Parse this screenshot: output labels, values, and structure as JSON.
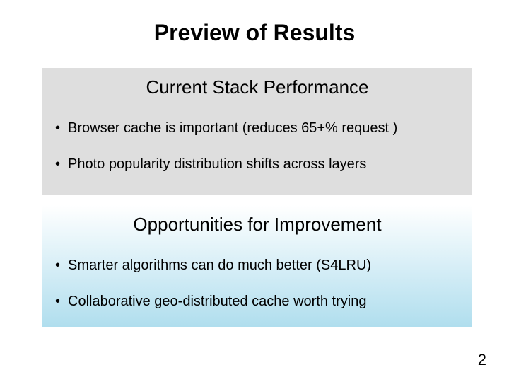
{
  "title": "Preview of Results",
  "panels": {
    "current": {
      "heading": "Current Stack Performance",
      "bullets": [
        "Browser cache is important (reduces 65+% request )",
        "Photo popularity distribution shifts across layers"
      ]
    },
    "improve": {
      "heading": "Opportunities for Improvement",
      "bullets": [
        "Smarter algorithms can do much better (S4LRU)",
        "Collaborative geo-distributed cache worth trying"
      ]
    }
  },
  "page_number": "2"
}
